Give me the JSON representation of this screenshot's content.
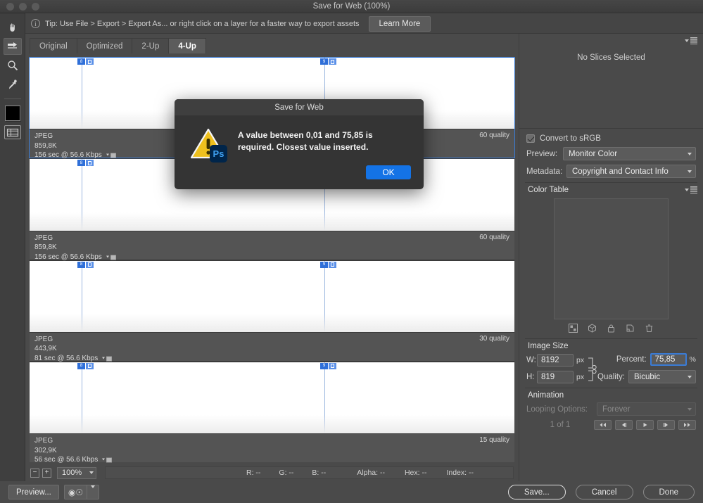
{
  "window": {
    "title": "Save for Web (100%)"
  },
  "tip": {
    "text": "Tip: Use File > Export > Export As...  or right click on a layer for a faster way to export assets",
    "info_icon": "info-icon",
    "learn_more": "Learn More"
  },
  "toolbar": {
    "items": [
      {
        "name": "hand-tool",
        "selected": false
      },
      {
        "name": "slice-select-tool",
        "selected": true
      },
      {
        "name": "zoom-tool",
        "selected": false
      },
      {
        "name": "eyedropper-tool",
        "selected": false
      },
      {
        "name": "foreground-color-swatch",
        "selected": false
      },
      {
        "name": "toggle-slices-visibility",
        "selected": false
      }
    ]
  },
  "tabs": [
    {
      "label": "Original",
      "active": false
    },
    {
      "label": "Optimized",
      "active": false
    },
    {
      "label": "2-Up",
      "active": false
    },
    {
      "label": "4-Up",
      "active": true
    }
  ],
  "panes": [
    {
      "format": "JPEG",
      "size": "859,8K",
      "speed": "156 sec @ 56.6 Kbps",
      "quality": "60 quality",
      "selected": true
    },
    {
      "format": "JPEG",
      "size": "859,8K",
      "speed": "156 sec @ 56.6 Kbps",
      "quality": "60 quality",
      "selected": false
    },
    {
      "format": "JPEG",
      "size": "443,9K",
      "speed": "81 sec @ 56.6 Kbps",
      "quality": "30 quality",
      "selected": false
    },
    {
      "format": "JPEG",
      "size": "302,9K",
      "speed": "56 sec @ 56.6 Kbps",
      "quality": "15 quality",
      "selected": false
    }
  ],
  "status": {
    "zoom_out": "−",
    "zoom_in": "+",
    "zoom_value": "100%",
    "r": "R: --",
    "g": "G: --",
    "b": "B: --",
    "alpha": "Alpha: --",
    "hex": "Hex: --",
    "index": "Index: --"
  },
  "right_panel": {
    "no_slices": "No Slices Selected",
    "convert_srgb": {
      "label": "Convert to sRGB",
      "checked": true
    },
    "preview": {
      "label": "Preview:",
      "value": "Monitor Color"
    },
    "metadata": {
      "label": "Metadata:",
      "value": "Copyright and Contact Info"
    },
    "color_table": {
      "title": "Color Table",
      "footer_icons": [
        "transparency-icon",
        "web-shift-icon",
        "lock-icon",
        "new-color-icon",
        "trash-icon"
      ]
    },
    "image_size": {
      "title": "Image Size",
      "w_label": "W:",
      "w_value": "8192",
      "w_unit": "px",
      "h_label": "H:",
      "h_value": "819",
      "h_unit": "px",
      "link_icon": "chain-link-icon",
      "percent_label": "Percent:",
      "percent_value": "75,85",
      "percent_unit": "%",
      "quality_label": "Quality:",
      "quality_value": "Bicubic"
    },
    "animation": {
      "title": "Animation",
      "looping_label": "Looping Options:",
      "looping_value": "Forever",
      "frame_counter": "1 of 1",
      "controls": [
        "first-frame-button",
        "previous-frame-button",
        "play-button",
        "next-frame-button",
        "last-frame-button"
      ]
    }
  },
  "bottom": {
    "preview_button": "Preview...",
    "browser_select": "browser-preview-select",
    "save": "Save...",
    "cancel": "Cancel",
    "done": "Done"
  },
  "alert": {
    "title": "Save for Web",
    "icon": "warning-triangle-icon",
    "app_badge": "Ps",
    "message_line1": "A value between 0,01 and 75,85 is",
    "message_line2": "required. Closest value inserted.",
    "ok": "OK"
  },
  "colors": {
    "accent_blue": "#3a7bd5",
    "ok_button": "#1473e6",
    "warning_yellow": "#f0c020",
    "panel_bg": "#4a4a4a"
  }
}
